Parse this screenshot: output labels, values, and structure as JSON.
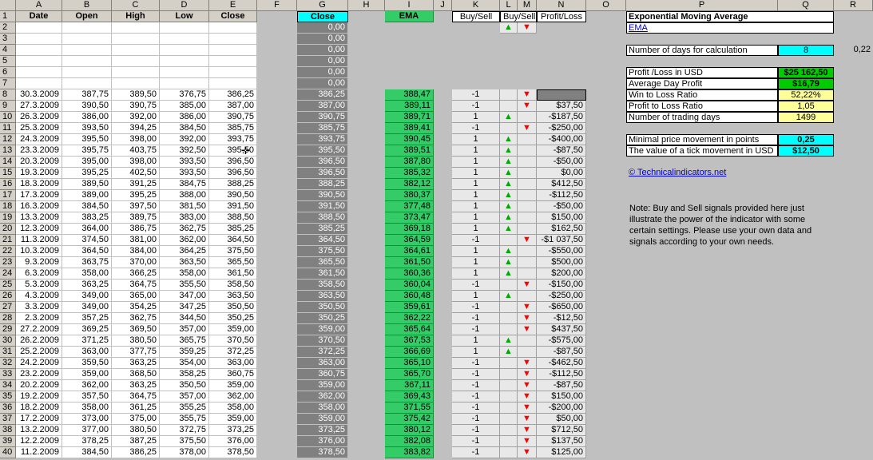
{
  "columns": [
    "A",
    "B",
    "C",
    "D",
    "E",
    "F",
    "G",
    "H",
    "I",
    "J",
    "K",
    "L",
    "M",
    "N",
    "O",
    "P",
    "Q",
    "R"
  ],
  "headers": {
    "date": "Date",
    "open": "Open",
    "high": "High",
    "low": "Low",
    "close": "Close",
    "g_close": "Close",
    "ema": "EMA",
    "k_buysell": "Buy/Sell",
    "m_buysell": "Buy/Sell",
    "profit_loss": "Profit/Loss"
  },
  "signal_legend": {
    "up": "▲",
    "down": "▼"
  },
  "row_numbers": [
    "1",
    "2",
    "3",
    "4",
    "5",
    "6",
    "7",
    "8",
    "9",
    "10",
    "11",
    "12",
    "13",
    "14",
    "15",
    "16",
    "17",
    "18",
    "19",
    "20",
    "21",
    "22",
    "23",
    "24",
    "25",
    "26",
    "27",
    "28",
    "29",
    "30",
    "31",
    "32",
    "33",
    "34",
    "35",
    "36",
    "37",
    "38",
    "39",
    "40"
  ],
  "empty_g": [
    "0,00",
    "0,00",
    "0,00",
    "0,00",
    "0,00",
    "0,00"
  ],
  "rows": [
    {
      "date": "30.3.2009",
      "open": "387,75",
      "high": "389,50",
      "low": "376,75",
      "close": "386,25",
      "g": "386,25",
      "ema": "388,47",
      "bs": "-1",
      "sig": "down",
      "pl": ""
    },
    {
      "date": "27.3.2009",
      "open": "390,50",
      "high": "390,75",
      "low": "385,00",
      "close": "387,00",
      "g": "387,00",
      "ema": "389,11",
      "bs": "-1",
      "sig": "down",
      "pl": "$37,50"
    },
    {
      "date": "26.3.2009",
      "open": "386,00",
      "high": "392,00",
      "low": "386,00",
      "close": "390,75",
      "g": "390,75",
      "ema": "389,71",
      "bs": "1",
      "sig": "up",
      "pl": "-$187,50"
    },
    {
      "date": "25.3.2009",
      "open": "393,50",
      "high": "394,25",
      "low": "384,50",
      "close": "385,75",
      "g": "385,75",
      "ema": "389,41",
      "bs": "-1",
      "sig": "down",
      "pl": "-$250,00"
    },
    {
      "date": "24.3.2009",
      "open": "395,50",
      "high": "398,00",
      "low": "392,00",
      "close": "393,75",
      "g": "393,75",
      "ema": "390,45",
      "bs": "1",
      "sig": "up",
      "pl": "-$400,00"
    },
    {
      "date": "23.3.2009",
      "open": "395,75",
      "high": "403,75",
      "low": "392,50",
      "close": "395,50",
      "g": "395,50",
      "ema": "389,51",
      "bs": "1",
      "sig": "up",
      "pl": "-$87,50"
    },
    {
      "date": "20.3.2009",
      "open": "395,00",
      "high": "398,00",
      "low": "393,50",
      "close": "396,50",
      "g": "396,50",
      "ema": "387,80",
      "bs": "1",
      "sig": "up",
      "pl": "-$50,00"
    },
    {
      "date": "19.3.2009",
      "open": "395,25",
      "high": "402,50",
      "low": "393,50",
      "close": "396,50",
      "g": "396,50",
      "ema": "385,32",
      "bs": "1",
      "sig": "up",
      "pl": "$0,00"
    },
    {
      "date": "18.3.2009",
      "open": "389,50",
      "high": "391,25",
      "low": "384,75",
      "close": "388,25",
      "g": "388,25",
      "ema": "382,12",
      "bs": "1",
      "sig": "up",
      "pl": "$412,50"
    },
    {
      "date": "17.3.2009",
      "open": "389,00",
      "high": "395,25",
      "low": "388,00",
      "close": "390,50",
      "g": "390,50",
      "ema": "380,37",
      "bs": "1",
      "sig": "up",
      "pl": "-$112,50"
    },
    {
      "date": "16.3.2009",
      "open": "384,50",
      "high": "397,50",
      "low": "381,50",
      "close": "391,50",
      "g": "391,50",
      "ema": "377,48",
      "bs": "1",
      "sig": "up",
      "pl": "-$50,00"
    },
    {
      "date": "13.3.2009",
      "open": "383,25",
      "high": "389,75",
      "low": "383,00",
      "close": "388,50",
      "g": "388,50",
      "ema": "373,47",
      "bs": "1",
      "sig": "up",
      "pl": "$150,00"
    },
    {
      "date": "12.3.2009",
      "open": "364,00",
      "high": "386,75",
      "low": "362,75",
      "close": "385,25",
      "g": "385,25",
      "ema": "369,18",
      "bs": "1",
      "sig": "up",
      "pl": "$162,50"
    },
    {
      "date": "11.3.2009",
      "open": "374,50",
      "high": "381,00",
      "low": "362,00",
      "close": "364,50",
      "g": "364,50",
      "ema": "364,59",
      "bs": "-1",
      "sig": "down",
      "pl": "-$1 037,50"
    },
    {
      "date": "10.3.2009",
      "open": "364,50",
      "high": "384,00",
      "low": "364,25",
      "close": "375,50",
      "g": "375,50",
      "ema": "364,61",
      "bs": "1",
      "sig": "up",
      "pl": "-$550,00"
    },
    {
      "date": "9.3.2009",
      "open": "363,75",
      "high": "370,00",
      "low": "363,50",
      "close": "365,50",
      "g": "365,50",
      "ema": "361,50",
      "bs": "1",
      "sig": "up",
      "pl": "$500,00"
    },
    {
      "date": "6.3.2009",
      "open": "358,00",
      "high": "366,25",
      "low": "358,00",
      "close": "361,50",
      "g": "361,50",
      "ema": "360,36",
      "bs": "1",
      "sig": "up",
      "pl": "$200,00"
    },
    {
      "date": "5.3.2009",
      "open": "363,25",
      "high": "364,75",
      "low": "355,50",
      "close": "358,50",
      "g": "358,50",
      "ema": "360,04",
      "bs": "-1",
      "sig": "down",
      "pl": "-$150,00"
    },
    {
      "date": "4.3.2009",
      "open": "349,00",
      "high": "365,00",
      "low": "347,00",
      "close": "363,50",
      "g": "363,50",
      "ema": "360,48",
      "bs": "1",
      "sig": "up",
      "pl": "-$250,00"
    },
    {
      "date": "3.3.2009",
      "open": "349,00",
      "high": "354,25",
      "low": "347,25",
      "close": "350,50",
      "g": "350,50",
      "ema": "359,61",
      "bs": "-1",
      "sig": "down",
      "pl": "-$650,00"
    },
    {
      "date": "2.3.2009",
      "open": "357,25",
      "high": "362,75",
      "low": "344,50",
      "close": "350,25",
      "g": "350,25",
      "ema": "362,22",
      "bs": "-1",
      "sig": "down",
      "pl": "-$12,50"
    },
    {
      "date": "27.2.2009",
      "open": "369,25",
      "high": "369,50",
      "low": "357,00",
      "close": "359,00",
      "g": "359,00",
      "ema": "365,64",
      "bs": "-1",
      "sig": "down",
      "pl": "$437,50"
    },
    {
      "date": "26.2.2009",
      "open": "371,25",
      "high": "380,50",
      "low": "365,75",
      "close": "370,50",
      "g": "370,50",
      "ema": "367,53",
      "bs": "1",
      "sig": "up",
      "pl": "-$575,00"
    },
    {
      "date": "25.2.2009",
      "open": "363,00",
      "high": "377,75",
      "low": "359,25",
      "close": "372,25",
      "g": "372,25",
      "ema": "366,69",
      "bs": "1",
      "sig": "up",
      "pl": "-$87,50"
    },
    {
      "date": "24.2.2009",
      "open": "359,50",
      "high": "363,25",
      "low": "354,00",
      "close": "363,00",
      "g": "363,00",
      "ema": "365,10",
      "bs": "-1",
      "sig": "down",
      "pl": "-$462,50"
    },
    {
      "date": "23.2.2009",
      "open": "359,00",
      "high": "368,50",
      "low": "358,25",
      "close": "360,75",
      "g": "360,75",
      "ema": "365,70",
      "bs": "-1",
      "sig": "down",
      "pl": "-$112,50"
    },
    {
      "date": "20.2.2009",
      "open": "362,00",
      "high": "363,25",
      "low": "350,50",
      "close": "359,00",
      "g": "359,00",
      "ema": "367,11",
      "bs": "-1",
      "sig": "down",
      "pl": "-$87,50"
    },
    {
      "date": "19.2.2009",
      "open": "357,50",
      "high": "364,75",
      "low": "357,00",
      "close": "362,00",
      "g": "362,00",
      "ema": "369,43",
      "bs": "-1",
      "sig": "down",
      "pl": "$150,00"
    },
    {
      "date": "18.2.2009",
      "open": "358,00",
      "high": "361,25",
      "low": "355,25",
      "close": "358,00",
      "g": "358,00",
      "ema": "371,55",
      "bs": "-1",
      "sig": "down",
      "pl": "-$200,00"
    },
    {
      "date": "17.2.2009",
      "open": "373,00",
      "high": "375,00",
      "low": "355,75",
      "close": "359,00",
      "g": "359,00",
      "ema": "375,42",
      "bs": "-1",
      "sig": "down",
      "pl": "$50,00"
    },
    {
      "date": "13.2.2009",
      "open": "377,00",
      "high": "380,50",
      "low": "372,75",
      "close": "373,25",
      "g": "373,25",
      "ema": "380,12",
      "bs": "-1",
      "sig": "down",
      "pl": "$712,50"
    },
    {
      "date": "12.2.2009",
      "open": "378,25",
      "high": "387,25",
      "low": "375,50",
      "close": "376,00",
      "g": "376,00",
      "ema": "382,08",
      "bs": "-1",
      "sig": "down",
      "pl": "$137,50"
    },
    {
      "date": "11.2.2009",
      "open": "384,50",
      "high": "386,25",
      "low": "378,00",
      "close": "378,50",
      "g": "378,50",
      "ema": "383,82",
      "bs": "-1",
      "sig": "down",
      "pl": "$125,00"
    }
  ],
  "panel": {
    "title": "Exponential Moving Average",
    "link": "EMA",
    "days_label": "Number of days for calculation",
    "days_value": "8",
    "r4_value": "0,22",
    "stats": [
      {
        "label": "Profit /Loss in USD",
        "value": "$25 162,50",
        "color": "#00cc00"
      },
      {
        "label": "Average Day Profit",
        "value": "$16,79",
        "color": "#00cc00"
      },
      {
        "label": "Win to Loss Ratio",
        "value": "52,22%",
        "color": "#ffff99"
      },
      {
        "label": "Profit to Loss Ratio",
        "value": "1,05",
        "color": "#ffff99"
      },
      {
        "label": "Number of trading days",
        "value": "1499",
        "color": "#ffff99"
      }
    ],
    "tick_label": "Minimal price movement in points",
    "tick_value": "0,25",
    "tick_usd_label": "The value of a tick movement in USD",
    "tick_usd_value": "$12,50",
    "copyright": "© Technicalindicators.net",
    "note": "Note: Buy and Sell signals provided here just illustrate the power of the indicator with some certain settings. Please use your own data and signals according to your own needs."
  }
}
